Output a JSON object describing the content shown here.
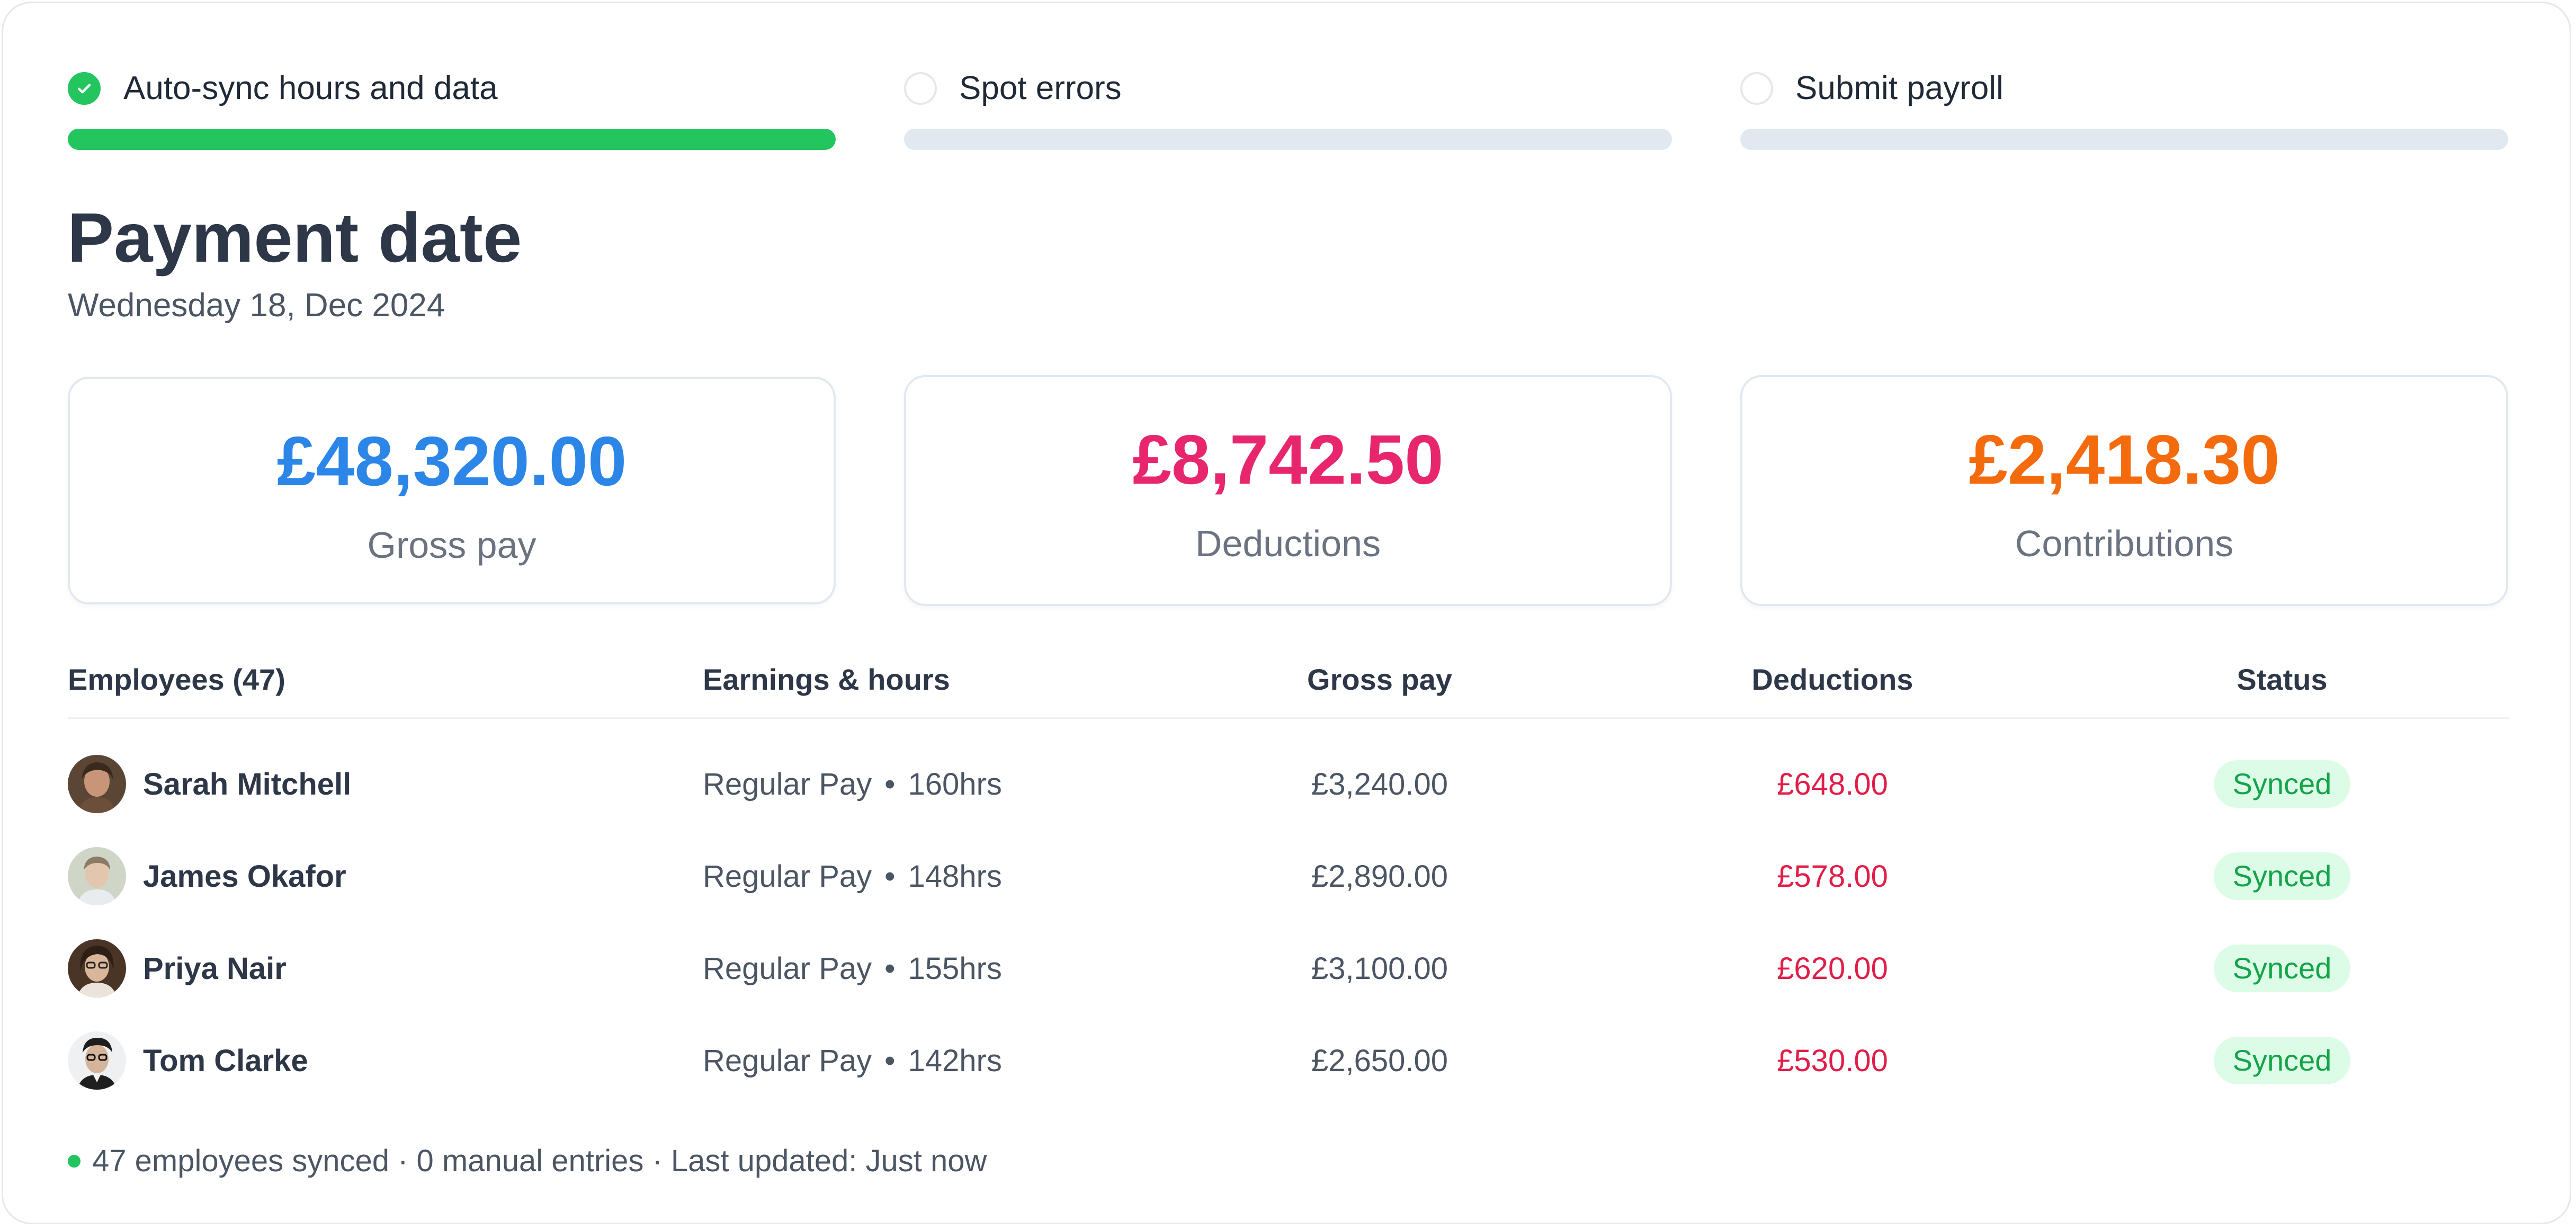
{
  "steps": [
    {
      "label": "Auto-sync hours and data",
      "status": "complete",
      "progress": 1.0
    },
    {
      "label": "Spot errors",
      "status": "pending",
      "progress": 0.0
    },
    {
      "label": "Submit payroll",
      "status": "pending",
      "progress": 0.0
    }
  ],
  "header": {
    "title": "Payment date",
    "date": "Wednesday 18, Dec 2024"
  },
  "summary": [
    {
      "value": "£48,320.00",
      "label": "Gross pay",
      "color": "#2b86e8"
    },
    {
      "value": "£8,742.50",
      "label": "Deductions",
      "color": "#e8266e"
    },
    {
      "value": "£2,418.30",
      "label": "Contributions",
      "color": "#f46b0e"
    }
  ],
  "table": {
    "headers": {
      "employees": "Employees (47)",
      "earnings": "Earnings & hours",
      "gross": "Gross pay",
      "deductions": "Deductions",
      "status": "Status"
    },
    "separator": "•",
    "rows": [
      {
        "name": "Sarah Mitchell",
        "pay_type": "Regular Pay",
        "hours": "160hrs",
        "gross": "£3,240.00",
        "deductions": "£648.00",
        "status": "Synced"
      },
      {
        "name": "James Okafor",
        "pay_type": "Regular Pay",
        "hours": "148hrs",
        "gross": "£2,890.00",
        "deductions": "£578.00",
        "status": "Synced"
      },
      {
        "name": "Priya Nair",
        "pay_type": "Regular Pay",
        "hours": "155hrs",
        "gross": "£3,100.00",
        "deductions": "£620.00",
        "status": "Synced"
      },
      {
        "name": "Tom Clarke",
        "pay_type": "Regular Pay",
        "hours": "142hrs",
        "gross": "£2,650.00",
        "deductions": "£530.00",
        "status": "Synced"
      }
    ]
  },
  "footer": {
    "text": "47 employees synced · 0 manual entries · Last updated: Just now"
  },
  "colors": {
    "accent_green": "#22c55e",
    "deduction_red": "#e11d48",
    "badge_bg": "#dcfce7",
    "badge_text": "#16a34a"
  }
}
